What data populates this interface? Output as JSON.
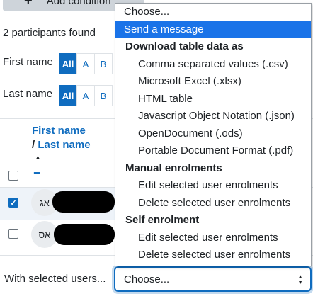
{
  "add_condition": {
    "label": "Add condition",
    "plus": "+"
  },
  "participants_count": "2 participants found",
  "filters": {
    "first_name_label": "First name",
    "last_name_label": "Last name",
    "letters": [
      "All",
      "A",
      "B"
    ]
  },
  "table": {
    "header_first": "First name",
    "header_sep": "/",
    "header_last": "Last name",
    "sort_icon": "▲",
    "dash": "−",
    "rows": [
      {
        "initials": "אג",
        "checked": true
      },
      {
        "initials": "אס",
        "checked": false
      }
    ]
  },
  "with_selected_label": "With selected users...",
  "select": {
    "value": "Choose..."
  },
  "dropdown": {
    "options": [
      {
        "label": "Choose...",
        "kind": "plain"
      },
      {
        "label": "Send a message",
        "kind": "selected"
      },
      {
        "label": "Download table data as",
        "kind": "group"
      },
      {
        "label": "Comma separated values (.csv)",
        "kind": "child"
      },
      {
        "label": "Microsoft Excel (.xlsx)",
        "kind": "child"
      },
      {
        "label": "HTML table",
        "kind": "child"
      },
      {
        "label": "Javascript Object Notation (.json)",
        "kind": "child"
      },
      {
        "label": "OpenDocument (.ods)",
        "kind": "child"
      },
      {
        "label": "Portable Document Format (.pdf)",
        "kind": "child"
      },
      {
        "label": "Manual enrolments",
        "kind": "group"
      },
      {
        "label": "Edit selected user enrolments",
        "kind": "child"
      },
      {
        "label": "Delete selected user enrolments",
        "kind": "child"
      },
      {
        "label": "Self enrolment",
        "kind": "group"
      },
      {
        "label": "Edit selected user enrolments",
        "kind": "child"
      },
      {
        "label": "Delete selected user enrolments",
        "kind": "child"
      }
    ]
  },
  "colors": {
    "accent": "#0f6cbf",
    "highlight": "#1a73e8"
  }
}
